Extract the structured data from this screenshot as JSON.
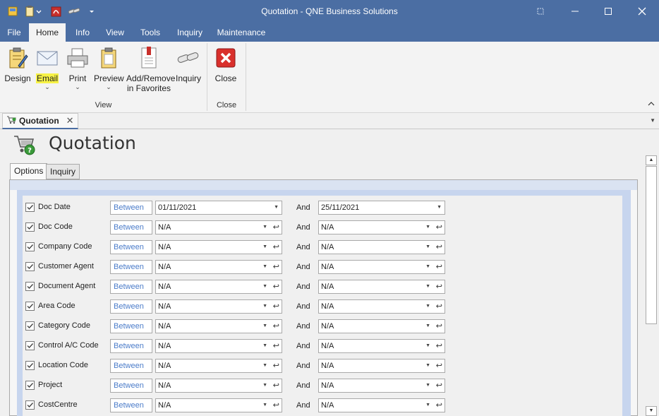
{
  "window": {
    "title": "Quotation - QNE Business Solutions"
  },
  "ribbon_tabs": [
    {
      "label": "File"
    },
    {
      "label": "Home"
    },
    {
      "label": "Info"
    },
    {
      "label": "View"
    },
    {
      "label": "Tools"
    },
    {
      "label": "Inquiry"
    },
    {
      "label": "Maintenance"
    }
  ],
  "ribbon": {
    "design": "Design",
    "email": "Email",
    "print": "Print",
    "preview": "Preview",
    "favorites_line1": "Add/Remove",
    "favorites_line2": "in Favorites",
    "inquiry": "Inquiry",
    "close": "Close",
    "group_view": "View",
    "group_close": "Close"
  },
  "doc_tab": {
    "label": "Quotation"
  },
  "page": {
    "title": "Quotation",
    "tabs": [
      "Options",
      "Inquiry"
    ]
  },
  "filters": {
    "between_label": "Between",
    "and_label": "And",
    "rows": [
      {
        "label": "Doc Date",
        "from": "01/11/2021",
        "to": "25/11/2021"
      },
      {
        "label": "Doc Code",
        "from": "N/A",
        "to": "N/A"
      },
      {
        "label": "Company Code",
        "from": "N/A",
        "to": "N/A"
      },
      {
        "label": "Customer Agent",
        "from": "N/A",
        "to": "N/A"
      },
      {
        "label": "Document Agent",
        "from": "N/A",
        "to": "N/A"
      },
      {
        "label": "Area Code",
        "from": "N/A",
        "to": "N/A"
      },
      {
        "label": "Category Code",
        "from": "N/A",
        "to": "N/A"
      },
      {
        "label": "Control A/C Code",
        "from": "N/A",
        "to": "N/A"
      },
      {
        "label": "Location Code",
        "from": "N/A",
        "to": "N/A"
      },
      {
        "label": "Project",
        "from": "N/A",
        "to": "N/A"
      },
      {
        "label": "CostCentre",
        "from": "N/A",
        "to": "N/A"
      }
    ]
  },
  "colors": {
    "titlebar": "#4b6ea3",
    "link_blue": "#4b7cc9",
    "close_red": "#d9302c"
  }
}
